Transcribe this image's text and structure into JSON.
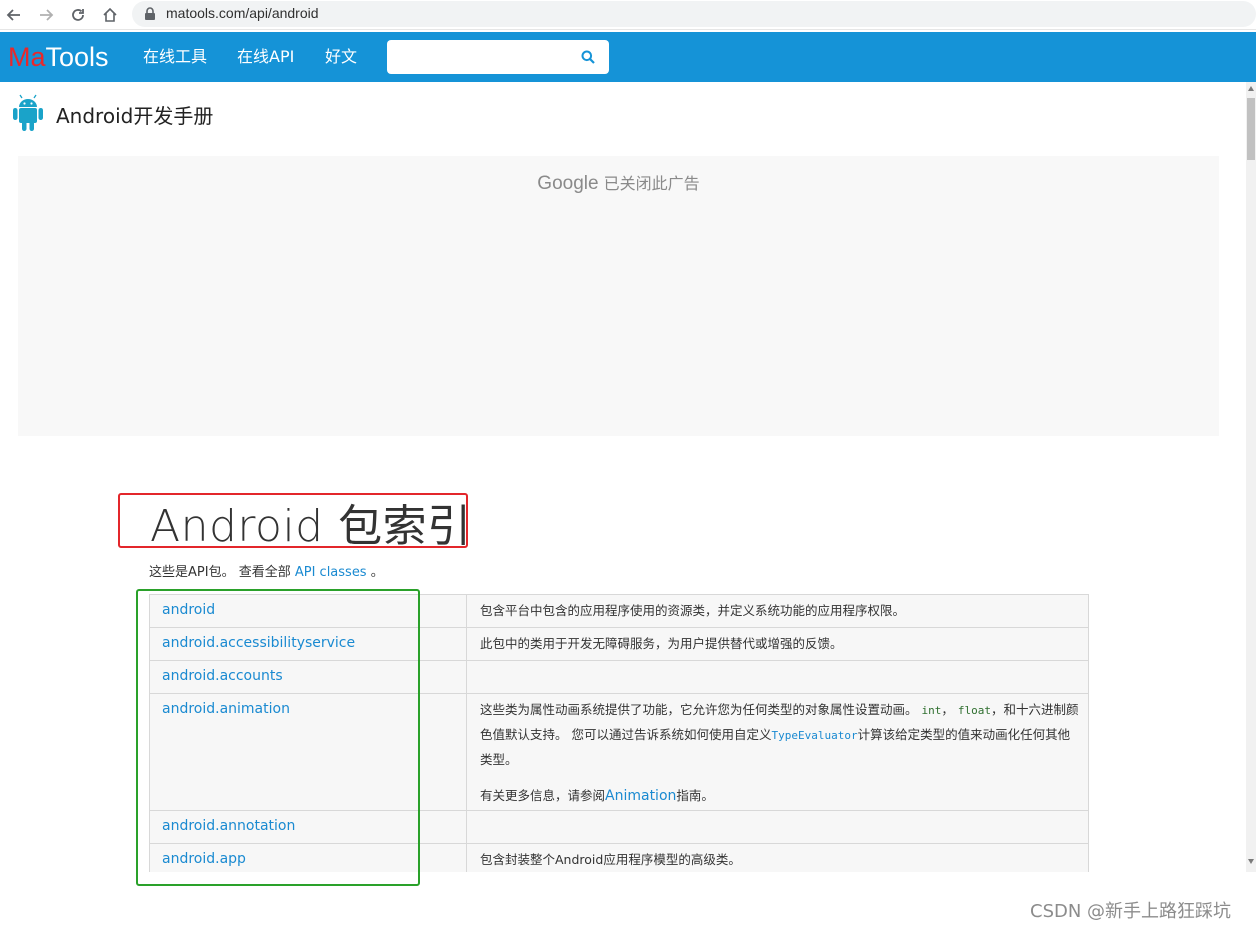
{
  "browser": {
    "url": "matools.com/api/android"
  },
  "header": {
    "logo_ma": "Ma",
    "logo_tools": "Tools",
    "nav": [
      "在线工具",
      "在线API",
      "好文"
    ],
    "search_placeholder": "",
    "colors": {
      "bar": "#1593d7",
      "logo_ma": "#e8282b"
    }
  },
  "page": {
    "title": "Android开发手册"
  },
  "ad": {
    "google": "Google",
    "text": "已关闭此广告"
  },
  "content": {
    "heading": "Android 包索引",
    "intro_text": "这些是API包。 查看全部",
    "intro_link": "API classes",
    "intro_end": "。"
  },
  "packages": [
    {
      "name": "android",
      "desc": "包含平台中包含的应用程序使用的资源类，并定义系统功能的应用程序权限。"
    },
    {
      "name": "android.accessibilityservice",
      "desc": "此包中的类用于开发无障碍服务，为用户提供替代或增强的反馈。"
    },
    {
      "name": "android.accounts",
      "desc": ""
    },
    {
      "name": "android.animation",
      "desc_a": "这些类为属性动画系统提供了功能，它允许您为任何类型的对象属性设置动画。",
      "code_int": "int",
      "code_float": "float",
      "desc_b": "和十六进制颜色值默认支持。 您可以通过告诉系统如何使用自定义",
      "code_evaluator": "TypeEvaluator",
      "desc_c": "计算该给定类型的值来动画化任何其他类型。",
      "desc_d": "有关更多信息，请参阅",
      "link_animation": "Animation",
      "desc_e": "指南。"
    },
    {
      "name": "android.annotation",
      "desc": ""
    },
    {
      "name": "android.app",
      "desc": "包含封装整个Android应用程序模型的高级类。"
    }
  ],
  "watermark": "CSDN @新手上路狂踩坑"
}
